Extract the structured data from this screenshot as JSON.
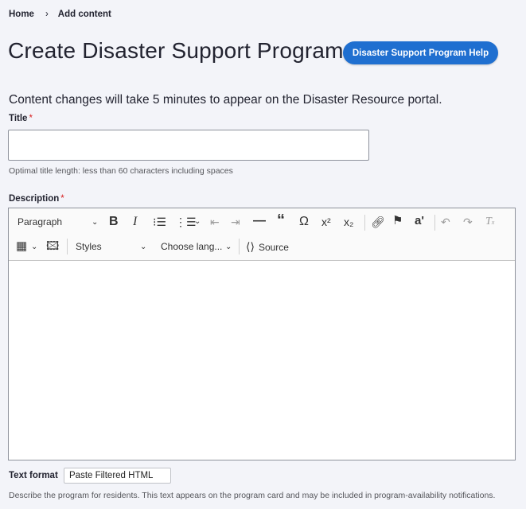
{
  "breadcrumb": {
    "home": "Home",
    "sep": "›",
    "current": "Add content"
  },
  "page": {
    "title": "Create Disaster Support Program",
    "help_button": "Disaster Support Program Help",
    "notice": "Content changes will take 5 minutes to appear on the Disaster Resource portal."
  },
  "title_field": {
    "label": "Title",
    "required_mark": "*",
    "value": "",
    "hint": "Optimal title length: less than 60 characters including spaces"
  },
  "description_field": {
    "label": "Description",
    "required_mark": "*",
    "toolbar": {
      "paragraph_select": "Paragraph",
      "styles_select": "Styles",
      "language_select": "Choose lang...",
      "source_label": "Source"
    },
    "text_format_label": "Text format",
    "text_format_value": "Paste Filtered HTML",
    "help": "Describe the program for residents. This text appears on the program card and may be included in program-availability notifications."
  },
  "colors": {
    "accent": "#1f6fd0",
    "required": "#d72222",
    "background": "#f3f4f9"
  }
}
